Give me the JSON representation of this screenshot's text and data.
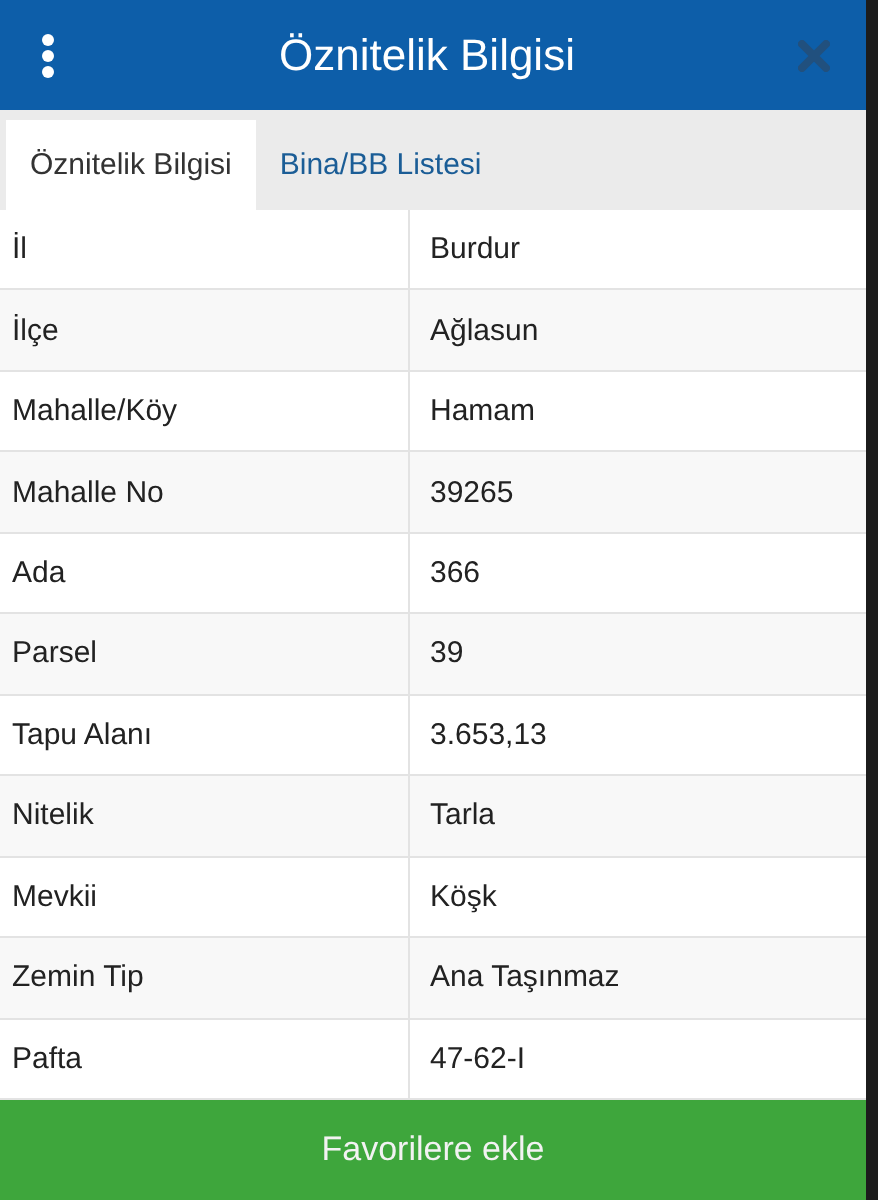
{
  "header": {
    "title": "Öznitelik Bilgisi"
  },
  "tabs": [
    {
      "label": "Öznitelik Bilgisi",
      "selected": true
    },
    {
      "label": "Bina/BB Listesi",
      "selected": false
    }
  ],
  "table": {
    "rows": [
      {
        "label": "İl",
        "value": "Burdur"
      },
      {
        "label": "İlçe",
        "value": "Ağlasun"
      },
      {
        "label": "Mahalle/Köy",
        "value": "Hamam"
      },
      {
        "label": "Mahalle No",
        "value": "39265"
      },
      {
        "label": "Ada",
        "value": "366"
      },
      {
        "label": "Parsel",
        "value": "39"
      },
      {
        "label": "Tapu Alanı",
        "value": "3.653,13"
      },
      {
        "label": "Nitelik",
        "value": "Tarla"
      },
      {
        "label": "Mevkii",
        "value": "Köşk"
      },
      {
        "label": "Zemin Tip",
        "value": "Ana Taşınmaz"
      },
      {
        "label": "Pafta",
        "value": "47-62-I"
      }
    ]
  },
  "footer_button": "Favorilere ekle"
}
